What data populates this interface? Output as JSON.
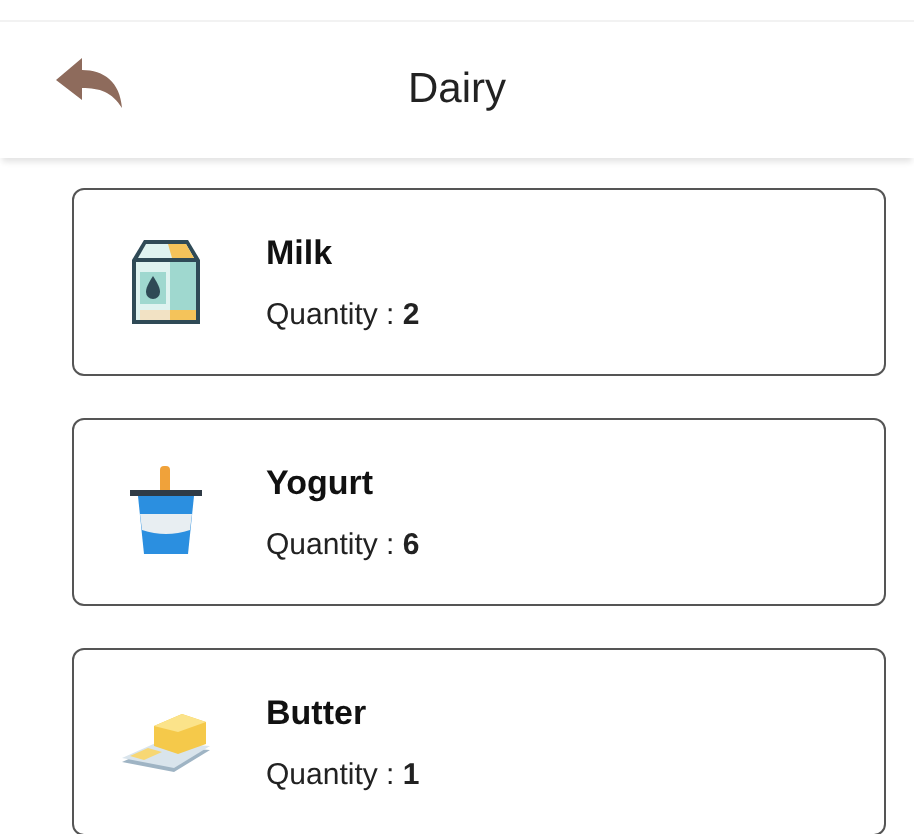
{
  "header": {
    "title": "Dairy"
  },
  "items": [
    {
      "kind": "milk",
      "name": "Milk",
      "quantity_label": "Quantity :",
      "quantity": "2"
    },
    {
      "kind": "yogurt",
      "name": "Yogurt",
      "quantity_label": "Quantity :",
      "quantity": "6"
    },
    {
      "kind": "butter",
      "name": "Butter",
      "quantity_label": "Quantity :",
      "quantity": "1"
    }
  ]
}
